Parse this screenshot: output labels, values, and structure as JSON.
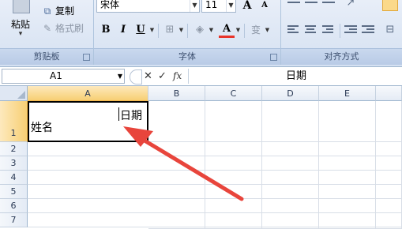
{
  "ribbon": {
    "clipboard": {
      "paste_label": "粘贴",
      "paste_arrow": "▾",
      "copy_label": "复制",
      "format_painter_label": "格式刷",
      "group_label": "剪贴板"
    },
    "font": {
      "font_name": "宋体",
      "font_size": "11",
      "grow_label": "A",
      "shrink_label": "A",
      "bold_label": "B",
      "italic_label": "I",
      "underline_label": "U",
      "font_color_label": "A",
      "phonetic_label": "变",
      "group_label": "字体"
    },
    "alignment": {
      "group_label": "对齐方式"
    }
  },
  "formula_bar": {
    "name_box": "A1",
    "cancel_symbol": "✕",
    "enter_symbol": "✓",
    "fx_label": "fx",
    "formula_value": "日期"
  },
  "sheet": {
    "columns": [
      "A",
      "B",
      "C",
      "D",
      "E"
    ],
    "rows": [
      "1",
      "2",
      "3",
      "4",
      "5",
      "6",
      "7"
    ],
    "a1_line1": "日期",
    "a1_line2": "姓名"
  },
  "colors": {
    "ribbon_bg": "#dbe5f4",
    "selected_header": "#f7cf74",
    "arrow": "#e8453c",
    "font_color_underline": "#e8342a"
  }
}
